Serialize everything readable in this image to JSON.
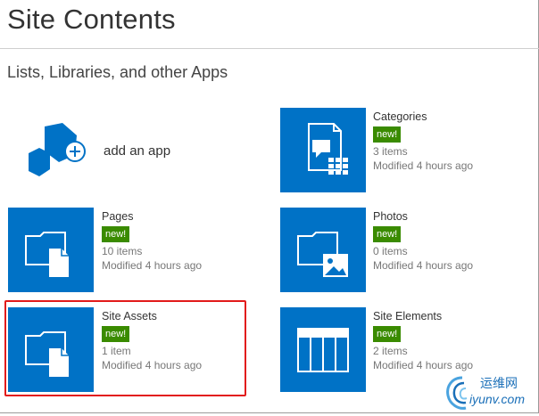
{
  "header": {
    "title": "Site Contents",
    "section_title": "Lists, Libraries, and other Apps"
  },
  "add_app": {
    "label": "add an app"
  },
  "apps": [
    {
      "name": "Categories",
      "badge": "new!",
      "count": "3 items",
      "modified": "Modified 4 hours ago",
      "icon": "list-grid-icon"
    },
    {
      "name": "Pages",
      "badge": "new!",
      "count": "10 items",
      "modified": "Modified 4 hours ago",
      "icon": "document-library-icon"
    },
    {
      "name": "Photos",
      "badge": "new!",
      "count": "0 items",
      "modified": "Modified 4 hours ago",
      "icon": "picture-library-icon"
    },
    {
      "name": "Site Assets",
      "badge": "new!",
      "count": "1 item",
      "modified": "Modified 4 hours ago",
      "icon": "document-library-icon"
    },
    {
      "name": "Site Elements",
      "badge": "new!",
      "count": "2 items",
      "modified": "Modified 4 hours ago",
      "icon": "custom-list-icon"
    }
  ],
  "watermark": {
    "line1": "运维网",
    "line2": "iyunv.com"
  },
  "colors": {
    "tile": "#0072c6",
    "badge": "#3a8b00",
    "highlight": "#e21b1b"
  }
}
